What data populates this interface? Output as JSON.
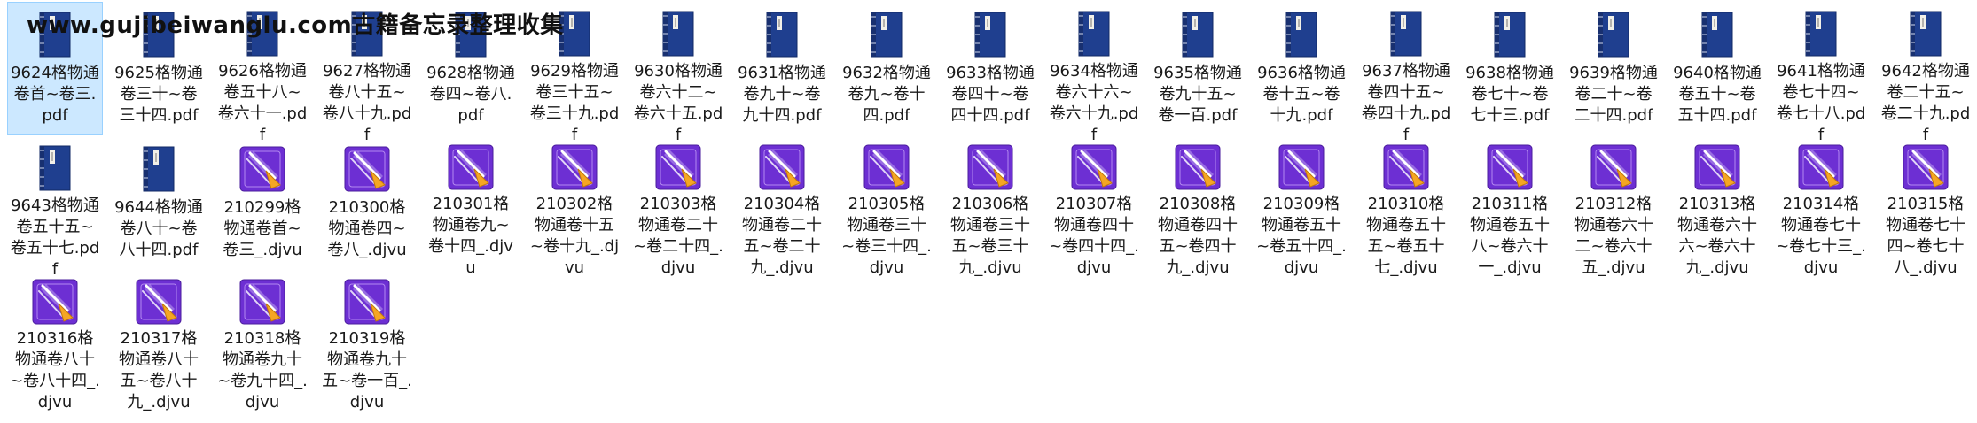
{
  "watermark": "www.gujibeiwanglu.com古籍备忘录整理收集",
  "colors": {
    "book_blue": "#1f3f8f",
    "book_spine": "#183070",
    "djvu_purple": "#6d2fd3",
    "djvu_orange": "#f5a623",
    "selection": "#cce8ff"
  },
  "rows": [
    {
      "items": [
        {
          "name": "9624格物通卷首~卷三.pdf",
          "icon": "pdf-book-icon",
          "selected": true
        },
        {
          "name": "9625格物通卷三十~卷三十四.pdf",
          "icon": "pdf-book-icon"
        },
        {
          "name": "9626格物通卷五十八~卷六十一.pdf",
          "icon": "pdf-book-icon"
        },
        {
          "name": "9627格物通卷八十五~卷八十九.pdf",
          "icon": "pdf-book-icon"
        },
        {
          "name": "9628格物通卷四~卷八.pdf",
          "icon": "pdf-book-icon"
        },
        {
          "name": "9629格物通卷三十五~卷三十九.pdf",
          "icon": "pdf-book-icon"
        },
        {
          "name": "9630格物通卷六十二~卷六十五.pdf",
          "icon": "pdf-book-icon"
        },
        {
          "name": "9631格物通卷九十~卷九十四.pdf",
          "icon": "pdf-book-icon"
        },
        {
          "name": "9632格物通卷九~卷十四.pdf",
          "icon": "pdf-book-icon"
        },
        {
          "name": "9633格物通卷四十~卷四十四.pdf",
          "icon": "pdf-book-icon"
        },
        {
          "name": "9634格物通卷六十六~卷六十九.pdf",
          "icon": "pdf-book-icon"
        },
        {
          "name": "9635格物通卷九十五~卷一百.pdf",
          "icon": "pdf-book-icon"
        },
        {
          "name": "9636格物通卷十五~卷十九.pdf",
          "icon": "pdf-book-icon"
        },
        {
          "name": "9637格物通卷四十五~卷四十九.pdf",
          "icon": "pdf-book-icon"
        },
        {
          "name": "9638格物通卷七十~卷七十三.pdf",
          "icon": "pdf-book-icon"
        },
        {
          "name": "9639格物通卷二十~卷二十四.pdf",
          "icon": "pdf-book-icon"
        },
        {
          "name": "9640格物通卷五十~卷五十四.pdf",
          "icon": "pdf-book-icon"
        },
        {
          "name": "9641格物通卷七十四~卷七十八.pdf",
          "icon": "pdf-book-icon"
        },
        {
          "name": "9642格物通卷二十五~卷二十九.pdf",
          "icon": "pdf-book-icon"
        }
      ]
    },
    {
      "items": [
        {
          "name": "9643格物通卷五十五~卷五十七.pdf",
          "icon": "pdf-book-icon"
        },
        {
          "name": "9644格物通卷八十~卷八十四.pdf",
          "icon": "pdf-book-icon"
        },
        {
          "name": "210299格物通卷首~卷三_.djvu",
          "icon": "djvu-file-icon"
        },
        {
          "name": "210300格物通卷四~卷八_.djvu",
          "icon": "djvu-file-icon"
        },
        {
          "name": "210301格物通卷九~卷十四_.djvu",
          "icon": "djvu-file-icon"
        },
        {
          "name": "210302格物通卷十五~卷十九_.djvu",
          "icon": "djvu-file-icon"
        },
        {
          "name": "210303格物通卷二十~卷二十四_.djvu",
          "icon": "djvu-file-icon"
        },
        {
          "name": "210304格物通卷二十五~卷二十九_.djvu",
          "icon": "djvu-file-icon"
        },
        {
          "name": "210305格物通卷三十~卷三十四_.djvu",
          "icon": "djvu-file-icon"
        },
        {
          "name": "210306格物通卷三十五~卷三十九_.djvu",
          "icon": "djvu-file-icon"
        },
        {
          "name": "210307格物通卷四十~卷四十四_.djvu",
          "icon": "djvu-file-icon"
        },
        {
          "name": "210308格物通卷四十五~卷四十九_.djvu",
          "icon": "djvu-file-icon"
        },
        {
          "name": "210309格物通卷五十~卷五十四_.djvu",
          "icon": "djvu-file-icon"
        },
        {
          "name": "210310格物通卷五十五~卷五十七_.djvu",
          "icon": "djvu-file-icon"
        },
        {
          "name": "210311格物通卷五十八~卷六十一_.djvu",
          "icon": "djvu-file-icon"
        },
        {
          "name": "210312格物通卷六十二~卷六十五_.djvu",
          "icon": "djvu-file-icon"
        },
        {
          "name": "210313格物通卷六十六~卷六十九_.djvu",
          "icon": "djvu-file-icon"
        },
        {
          "name": "210314格物通卷七十~卷七十三_.djvu",
          "icon": "djvu-file-icon"
        },
        {
          "name": "210315格物通卷七十四~卷七十八_.djvu",
          "icon": "djvu-file-icon"
        }
      ]
    },
    {
      "items": [
        {
          "name": "210316格物通卷八十~卷八十四_.djvu",
          "icon": "djvu-file-icon"
        },
        {
          "name": "210317格物通卷八十五~卷八十九_.djvu",
          "icon": "djvu-file-icon"
        },
        {
          "name": "210318格物通卷九十~卷九十四_.djvu",
          "icon": "djvu-file-icon"
        },
        {
          "name": "210319格物通卷九十五~卷一百_.djvu",
          "icon": "djvu-file-icon"
        }
      ]
    }
  ]
}
